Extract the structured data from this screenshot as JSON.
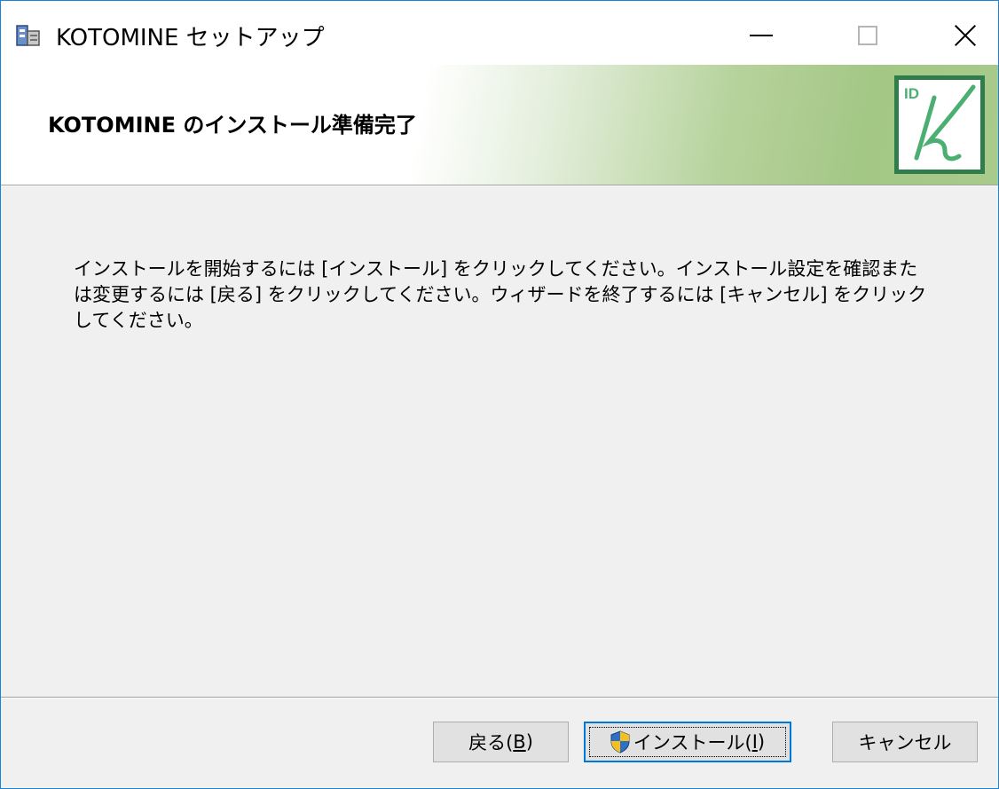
{
  "window": {
    "title": "KOTOMINE セットアップ",
    "controls": {
      "minimize": "minimize-icon",
      "maximize": "maximize-icon",
      "close": "close-icon"
    }
  },
  "banner": {
    "heading": "KOTOMINE のインストール準備完了",
    "logo_text": "ID",
    "logo_colors": {
      "border": "#2e7d4a",
      "letter": "#4caf72"
    }
  },
  "body": {
    "lines": [
      "インストールを開始するには [インストール] をクリックしてください。インストール設定を確認また",
      "は変更するには [戻る] をクリックしてください。ウィザードを終了するには [キャンセル] をクリック",
      "してください。"
    ]
  },
  "buttons": {
    "back": {
      "label": "戻る(",
      "accel": "B",
      "close": ")"
    },
    "install": {
      "label": "インストール(",
      "accel": "I",
      "close": ")",
      "icon": "uac-shield-icon"
    },
    "cancel": {
      "label": "キャンセル"
    }
  },
  "colors": {
    "accent": "#0078d7",
    "window_border": "#1883d7",
    "background": "#f0f0f0"
  }
}
